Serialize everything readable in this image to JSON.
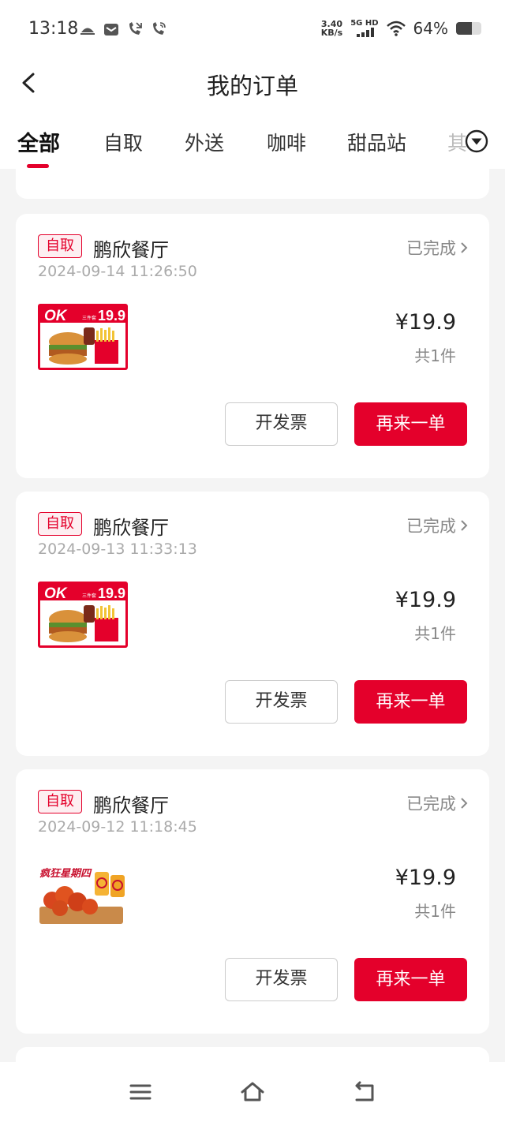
{
  "status_bar": {
    "time": "13:18",
    "net_speed_value": "3.40",
    "net_speed_unit": "KB/s",
    "network_type": "5G HD",
    "battery_text": "64%",
    "battery_level": 0.64
  },
  "header": {
    "title": "我的订单"
  },
  "tabs": [
    {
      "label": "全部",
      "active": true
    },
    {
      "label": "自取",
      "active": false
    },
    {
      "label": "外送",
      "active": false
    },
    {
      "label": "咖啡",
      "active": false
    },
    {
      "label": "甜品站",
      "active": false
    },
    {
      "label": "其",
      "active": false
    }
  ],
  "orders": [
    {
      "tag": "自取",
      "store": "鹏欣餐厅",
      "status": "已完成",
      "time": "2024-09-14 11:26:50",
      "image": "burger-fries-combo",
      "image_text": {
        "badge": "OK",
        "price": "19.9",
        "sub": "三件套"
      },
      "price": "¥19.9",
      "count": "共1件",
      "invoice_label": "开发票",
      "reorder_label": "再来一单"
    },
    {
      "tag": "自取",
      "store": "鹏欣餐厅",
      "status": "已完成",
      "time": "2024-09-13 11:33:13",
      "image": "burger-fries-combo",
      "image_text": {
        "badge": "OK",
        "price": "19.9",
        "sub": "三件套"
      },
      "price": "¥19.9",
      "count": "共1件",
      "invoice_label": "开发票",
      "reorder_label": "再来一单"
    },
    {
      "tag": "自取",
      "store": "鹏欣餐厅",
      "status": "已完成",
      "time": "2024-09-12 11:18:45",
      "image": "fried-chicken-drinks",
      "image_text": {
        "badge": "疯狂星期四"
      },
      "price": "¥19.9",
      "count": "共1件",
      "invoice_label": "开发票",
      "reorder_label": "再来一单"
    }
  ],
  "colors": {
    "accent": "#e4002b",
    "background": "#f4f4f4",
    "card": "#ffffff",
    "muted_text": "#888888"
  },
  "nav_bar": {
    "icons": [
      "menu-icon",
      "home-icon",
      "back-icon"
    ]
  }
}
